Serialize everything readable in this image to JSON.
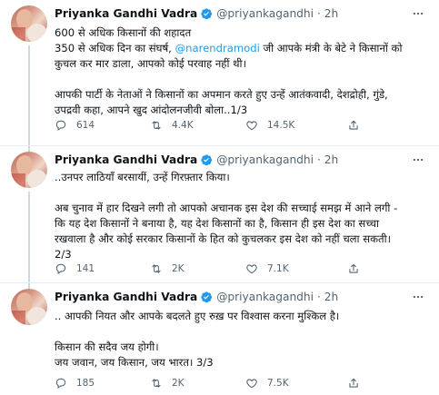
{
  "tweets": [
    {
      "name": "Priyanka Gandhi Vadra",
      "handle": "@priyankagandhi",
      "time": "· 2h",
      "l1": "600 से अधिक किसानों की शहादत",
      "l2a": "350 से अधिक दिन का संघर्ष, ",
      "mention": "@narendramodi",
      "l2b": " जी आपके मंत्री के बेटे ने किसानों को",
      "l3": "कुचल कर मार डाला, आपको कोई परवाह नहीं थी।",
      "l4": "आपकी पार्टी के नेताओं ने किसानों का अपमान करते हुए उन्हें आतंकवादी, देशद्रोही, गुंडे,",
      "l5": "उपद्रवी कहा, आपने खुद आंदोलनजीवी बोला..1/3",
      "replies": "614",
      "retweets": "4.4K",
      "likes": "14.5K"
    },
    {
      "name": "Priyanka Gandhi Vadra",
      "handle": "@priyankagandhi",
      "time": "· 2h",
      "l1": "..उनपर लाठियाँ बरसायीं, उन्हें गिरफ़्तार किया।",
      "l2": "अब चुनाव में हार दिखने लगी तो आपको अचानक इस देश की सच्चाई समझ में आने लगी -",
      "l3": "कि यह देश किसानों ने बनाया है, यह देश किसानों का है, किसान ही इस देश का सच्चा",
      "l4": "रखवाला है और कोई सरकार किसानों के हित को कुचलकर इस देश को नहीं चला सकती।",
      "l5": "2/3",
      "replies": "141",
      "retweets": "2K",
      "likes": "7.1K"
    },
    {
      "name": "Priyanka Gandhi Vadra",
      "handle": "@priyankagandhi",
      "time": "· 2h",
      "l1": ".. आपकी नियत और आपके बदलते हुए रुख़ पर विश्वास करना मुश्किल है।",
      "l2": "किसान की सदैव जय होगी।",
      "l3": "जय जवान, जय किसान, जय भारत। 3/3",
      "replies": "185",
      "retweets": "2K",
      "likes": "7.5K"
    }
  ],
  "icons": {
    "verified": "verified-badge-icon",
    "more": "more-icon",
    "reply": "reply-icon",
    "retweet": "retweet-icon",
    "like": "like-icon",
    "share": "share-icon"
  },
  "colors": {
    "accent": "#1d9bf0",
    "secondary_text": "#536471"
  }
}
